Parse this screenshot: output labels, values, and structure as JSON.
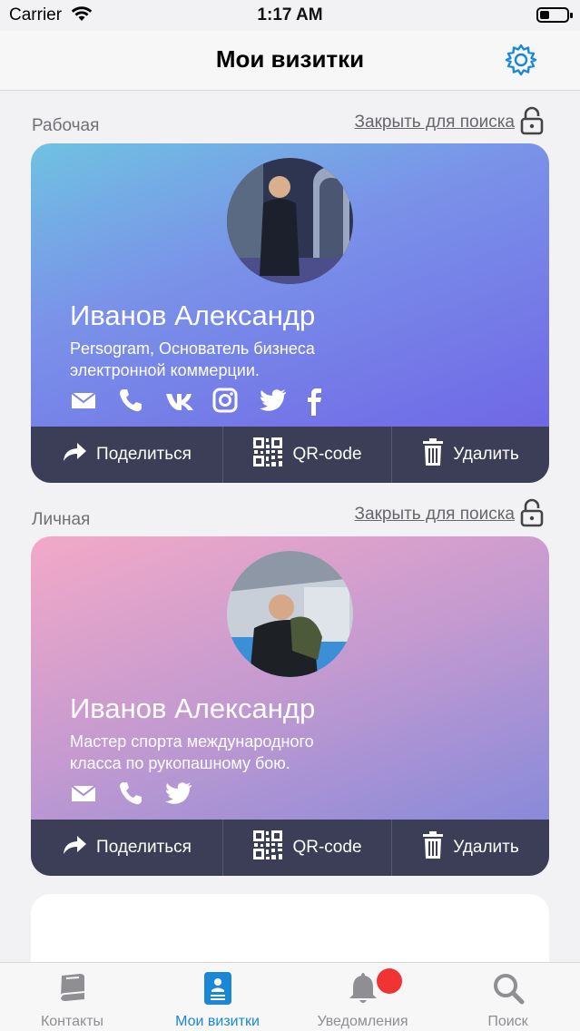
{
  "status": {
    "carrier": "Carrier",
    "time": "1:17 AM"
  },
  "nav": {
    "title": "Мои визитки",
    "settings_icon": "gear-icon"
  },
  "cards": [
    {
      "section": "Рабочая",
      "lock_link": "Закрыть для поиска",
      "name": "Иванов Александр",
      "description": "Persogram, Основатель бизнеса электронной коммерции.",
      "socials": [
        "email-icon",
        "phone-icon",
        "vk-icon",
        "instagram-icon",
        "twitter-icon",
        "facebook-icon"
      ],
      "actions": {
        "share": "Поделиться",
        "qr": "QR-code",
        "delete": "Удалить"
      }
    },
    {
      "section": "Личная",
      "lock_link": "Закрыть для поиска",
      "name": "Иванов Александр",
      "description": "Мастер спорта международного класса по рукопашному бою.",
      "socials": [
        "email-icon",
        "phone-icon",
        "twitter-icon"
      ],
      "actions": {
        "share": "Поделиться",
        "qr": "QR-code",
        "delete": "Удалить"
      }
    }
  ],
  "tabs": [
    {
      "label": "Контакты",
      "icon": "book-icon",
      "active": false
    },
    {
      "label": "Мои визитки",
      "icon": "card-icon",
      "active": true
    },
    {
      "label": "Уведомления",
      "icon": "bell-icon",
      "active": false,
      "badge": true
    },
    {
      "label": "Поиск",
      "icon": "search-icon",
      "active": false
    }
  ],
  "colors": {
    "accent": "#1a88d6",
    "action_bar": "#3b3e56",
    "badge": "#f23333"
  }
}
